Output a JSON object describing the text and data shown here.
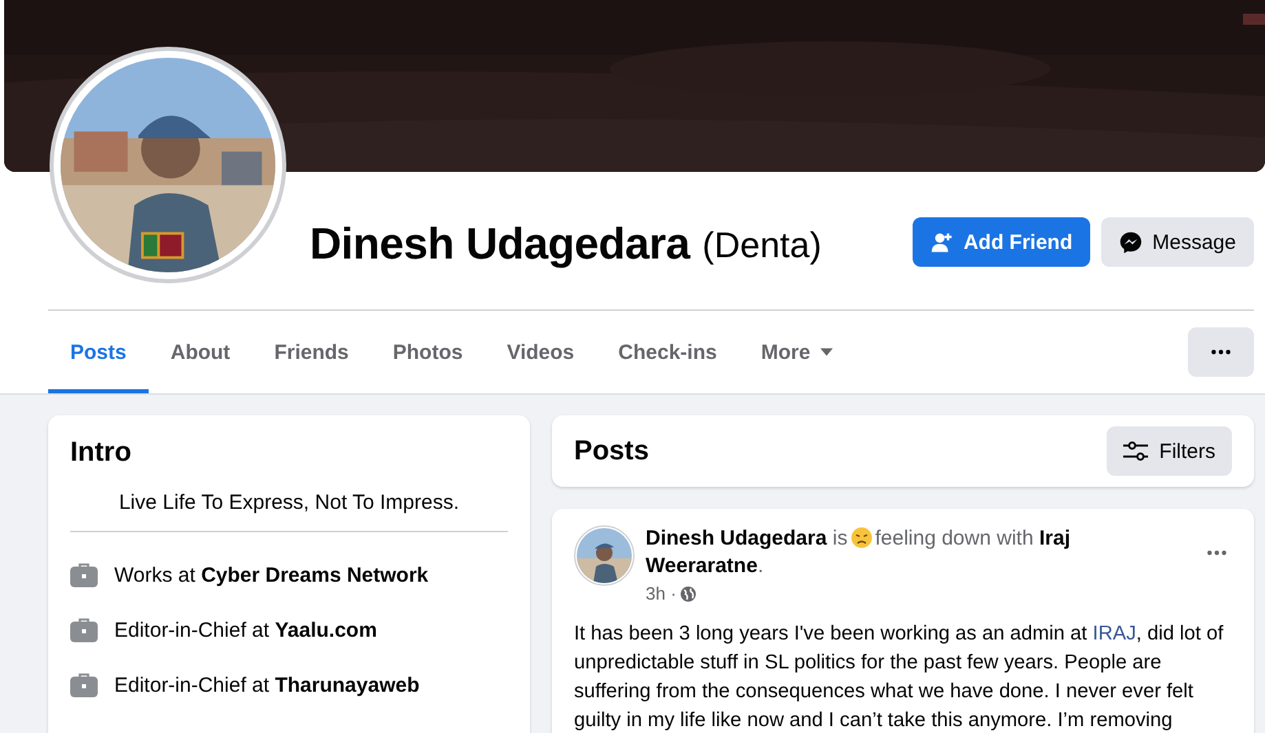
{
  "profile": {
    "name": "Dinesh Udagedara",
    "nickname": "(Denta)"
  },
  "actions": [
    {
      "kind": "add_friend",
      "label": "Add Friend"
    },
    {
      "kind": "message",
      "label": "Message"
    }
  ],
  "tabs": [
    {
      "label": "Posts",
      "selected": true,
      "dropdown": false
    },
    {
      "label": "About",
      "selected": false,
      "dropdown": false
    },
    {
      "label": "Friends",
      "selected": false,
      "dropdown": false
    },
    {
      "label": "Photos",
      "selected": false,
      "dropdown": false
    },
    {
      "label": "Videos",
      "selected": false,
      "dropdown": false
    },
    {
      "label": "Check-ins",
      "selected": false,
      "dropdown": false
    },
    {
      "label": "More",
      "selected": false,
      "dropdown": true
    }
  ],
  "intro": {
    "title": "Intro",
    "bio": "Live Life To Express, Not To Impress.",
    "items": [
      {
        "text": "Works at **Cyber Dreams Network**"
      },
      {
        "text": "Editor-in-Chief at **Yaalu.com**"
      },
      {
        "text": "Editor-in-Chief at **Tharunayaweb**"
      }
    ]
  },
  "posts_header": {
    "title": "Posts",
    "filter_label": "Filters"
  },
  "post": {
    "author_line": "**Dinesh Udagedara** is",
    "feeling_line": "feeling down with **Iraj**",
    "feeling_line_2": "**Weeraratne**.",
    "time": "3h ·",
    "body_before": "It has been 3 long years I've been working as an admin at ",
    "body_link": "IRAJ",
    "body_after": ", did lot of unpredictable stuff in SL politics for the past few years. People are suffering from the consequences what we have done. I never ever felt guilty in my life like now and I can’t take this anymore. I’m removing"
  }
}
